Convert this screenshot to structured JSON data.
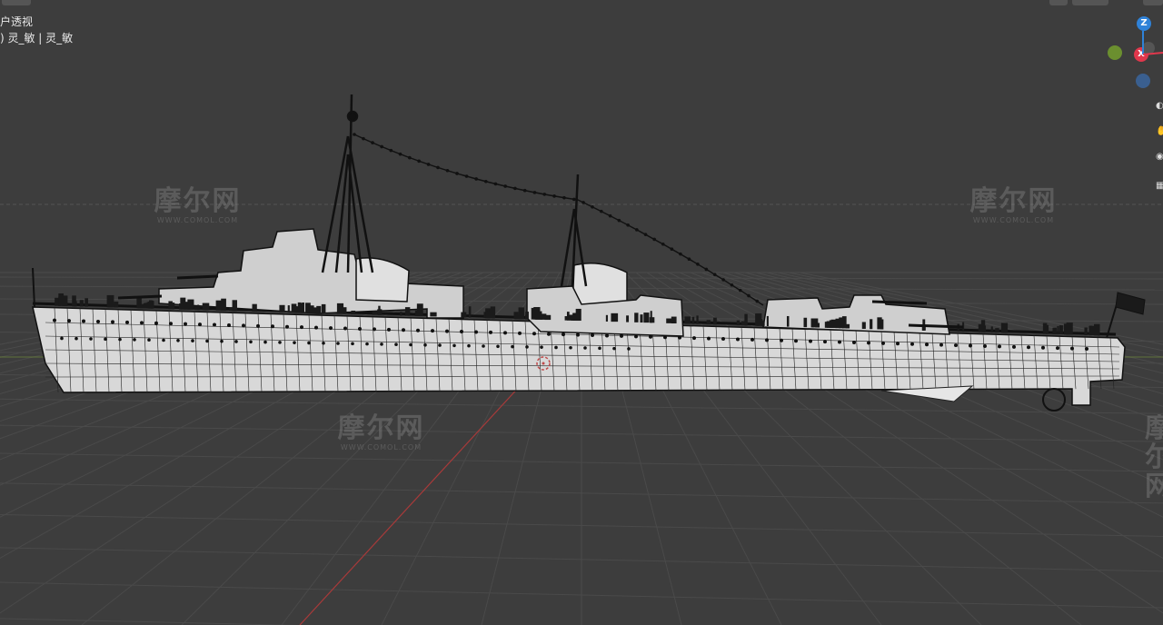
{
  "viewport": {
    "view_label": "户透视",
    "object_label": ") 灵_敏 | 灵_敏",
    "background": "#3d3d3d",
    "grid_color": "#4a4a4a",
    "x_axis_color": "#a83a3a",
    "y_axis_color": "#6f8a3a"
  },
  "gizmo": {
    "z_label": "Z",
    "x_label": "X",
    "z_color": "#2f82d8",
    "x_color": "#e0374c",
    "y_color": "#6b8f2f",
    "neg_z_color": "#3a5f8f"
  },
  "right_toolbar": {
    "icons": [
      "zoom-icon",
      "hand-icon",
      "camera-icon",
      "grid-icon"
    ]
  },
  "watermark": {
    "text": "摩尔网",
    "subtext": "WWW.COMOL.COM"
  },
  "model": {
    "name": "灵_敏",
    "display": "wireframe"
  }
}
